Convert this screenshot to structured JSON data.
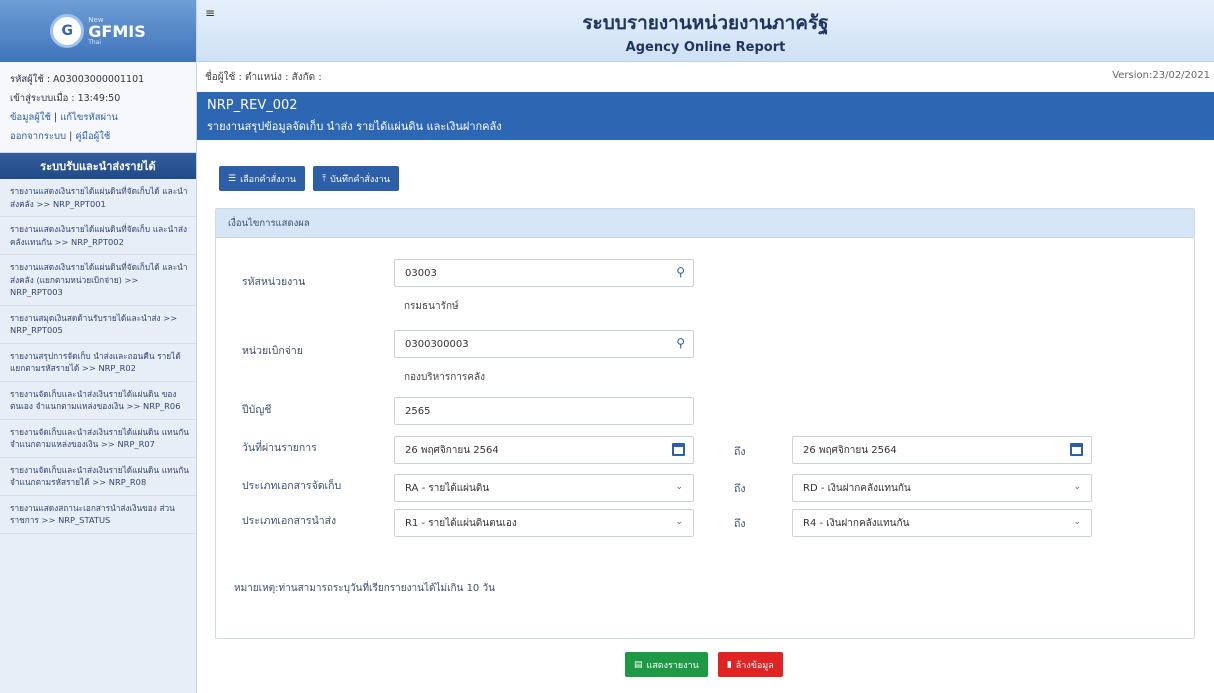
{
  "sidebar": {
    "logo": {
      "small": "New",
      "main": "GFMIS",
      "sub": "Thai"
    },
    "user_id": "รหัสผู้ใช้ : A03003000001101",
    "login_time": "เข้าสู่ระบบเมื่อ : 13:49:50",
    "links": {
      "user_info": "ข้อมูลผู้ใช้",
      "edit_password": "แก้ไขรหัสผ่าน",
      "logout": "ออกจากระบบ",
      "manual": "คู่มือผู้ใช้"
    },
    "menu_title": "ระบบรับและนำส่งรายได้",
    "menu_items": [
      "รายงานแสดงเงินรายได้แผ่นดินที่จัดเก็บได้ และนำส่งคลัง >> NRP_RPT001",
      "รายงานแสดงเงินรายได้แผ่นดินที่จัดเก็บ และนำส่งคลังแทนกัน >> NRP_RPT002",
      "รายงานแสดงเงินรายได้แผ่นดินที่จัดเก็บได้ และนำส่งคลัง (แยกตามหน่วยเบิกจ่าย) >> NRP_RPT003",
      "รายงานสมุดเงินสดด้านรับรายได้และนำส่ง >> NRP_RPT005",
      "รายงานสรุปการจัดเก็บ นำส่งและถอนคืน รายได้ แยกตามรหัสรายได้ >> NRP_R02",
      "รายงานจัดเก็บและนำส่งเงินรายได้แผ่นดิน ของตนเอง จำแนกตามแหล่งของเงิน >> NRP_R06",
      "รายงานจัดเก็บและนำส่งเงินรายได้แผ่นดิน แทนกัน จำแนกตามแหล่งของเงิน >> NRP_R07",
      "รายงานจัดเก็บและนำส่งเงินรายได้แผ่นดิน แทนกัน จำแนกตามรหัสรายได้ >> NRP_R08",
      "รายงานแสดงสถานะเอกสารนำส่งเงินของ ส่วนราชการ >> NRP_STATUS"
    ]
  },
  "header": {
    "title_th": "ระบบรายงานหน่วยงานภาครัฐ",
    "title_en": "Agency Online Report",
    "user_line": "ชื่อผู้ใช้ : ตำแหน่ง : สังกัด :",
    "version": "Version:23/02/2021"
  },
  "report": {
    "code": "NRP_REV_002",
    "title": "รายงานสรุปข้อมูลจัดเก็บ นำส่ง รายได้แผ่นดิน และเงินฝากคลัง"
  },
  "toolbar": {
    "select_cmd": "เลือกคำสั่งงาน",
    "save_cmd": "บันทึกคำสั่งงาน"
  },
  "panel": {
    "heading": "เงื่อนไขการแสดงผล",
    "agency_label": "รหัสหน่วยงาน",
    "agency_value": "03003",
    "agency_name": "กรมธนารักษ์",
    "disb_label": "หน่วยเบิกจ่าย",
    "disb_value": "0300300003",
    "disb_name": "กองบริหารการคลัง",
    "year_label": "ปีบัญชี",
    "year_value": "2565",
    "date_label": "วันที่ผ่านรายการ",
    "date_from": "26 พฤศจิกายน 2564",
    "date_to": "26 พฤศจิกายน 2564",
    "to_word": "ถึง",
    "collect_label": "ประเภทเอกสารจัดเก็บ",
    "collect_from": "RA - รายได้แผ่นดิน",
    "collect_to": "RD - เงินฝากคลังแทนกัน",
    "remit_label": "ประเภทเอกสารนำส่ง",
    "remit_from": "R1 - รายได้แผ่นดินตนเอง",
    "remit_to": "R4 - เงินฝากคลังแทนกัน",
    "note": "หมายเหตุ:ท่านสามารถระบุวันที่เรียกรายงานได้ไม่เกิน 10 วัน"
  },
  "actions": {
    "show_report": "แสดงรายงาน",
    "clear": "ล้างข้อมูล"
  }
}
